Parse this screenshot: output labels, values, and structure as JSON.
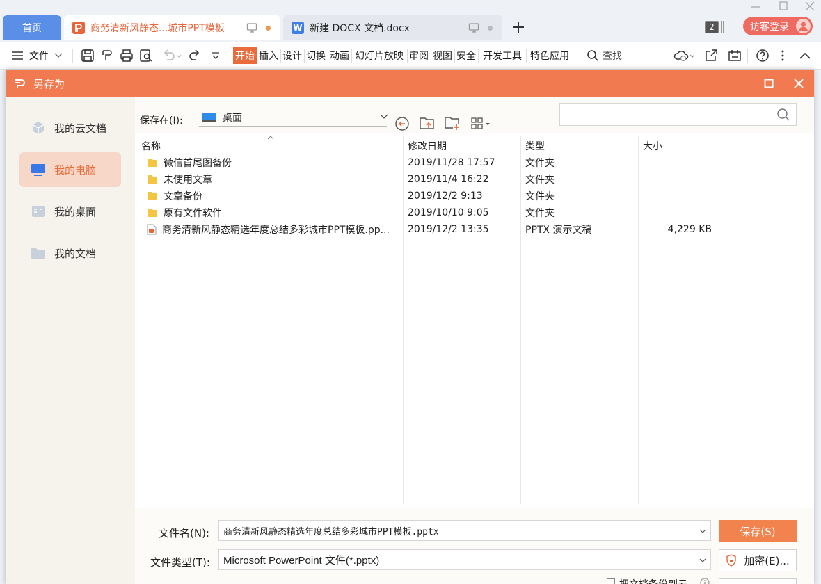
{
  "tabs": {
    "home": "首页",
    "doc1": "商务清新风静态...城市PPT模板",
    "doc2": "新建 DOCX 文档.docx",
    "count": "2",
    "login": "访客登录"
  },
  "ribbon": {
    "file": "文件",
    "tabs": [
      "开始",
      "插入",
      "设计",
      "切换",
      "动画",
      "幻灯片放映",
      "审阅",
      "视图",
      "安全",
      "开发工具",
      "特色应用"
    ],
    "search": "查找"
  },
  "dialog": {
    "title": "另存为",
    "sidebar": [
      "我的云文档",
      "我的电脑",
      "我的桌面",
      "我的文档"
    ],
    "save_in_label": "保存在(I):",
    "location": "桌面",
    "columns": {
      "name": "名称",
      "date": "修改日期",
      "type": "类型",
      "size": "大小"
    },
    "files": [
      {
        "name": "微信首尾图备份",
        "date": "2019/11/28 17:57",
        "type": "文件夹",
        "size": ""
      },
      {
        "name": "未使用文章",
        "date": "2019/11/4 16:22",
        "type": "文件夹",
        "size": ""
      },
      {
        "name": "文章备份",
        "date": "2019/12/2 9:13",
        "type": "文件夹",
        "size": ""
      },
      {
        "name": "原有文件软件",
        "date": "2019/10/10 9:05",
        "type": "文件夹",
        "size": ""
      },
      {
        "name": "商务清新风静态精选年度总结多彩城市PPT模板.pp...",
        "date": "2019/12/2 13:35",
        "type": "PPTX 演示文稿",
        "size": "4,229 KB"
      }
    ],
    "filename_label": "文件名(N):",
    "filename": "商务清新风静态精选年度总结多彩城市PPT模板.pptx",
    "filetype_label": "文件类型(T):",
    "filetype": "Microsoft PowerPoint 文件(*.pptx)",
    "save_button": "保存(S)",
    "encrypt_button": "加密(E)...",
    "backup_checkbox": "把文档备份到云"
  },
  "colors": {
    "accent": "#f27a50",
    "home_tab": "#5b8ee6",
    "login": "#ef6b62"
  }
}
